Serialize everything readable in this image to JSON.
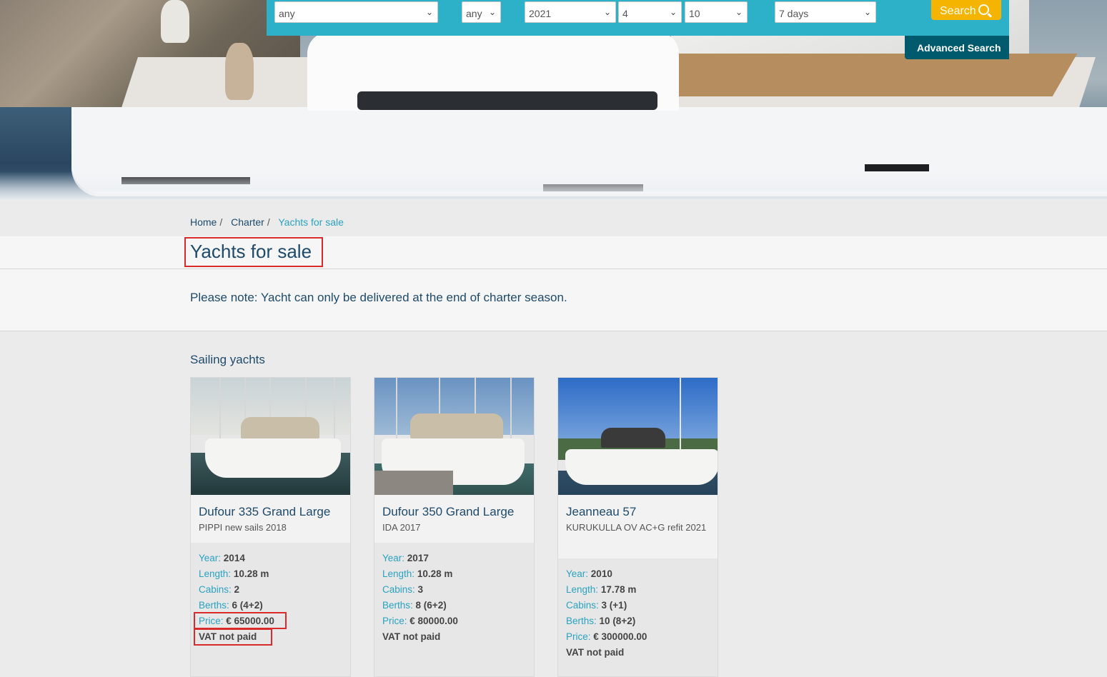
{
  "search": {
    "fields": [
      {
        "value": "any"
      },
      {
        "value": "any"
      },
      {
        "value": "2021"
      },
      {
        "value": "4"
      },
      {
        "value": "10"
      },
      {
        "value": "7 days"
      }
    ],
    "search_label": "Search",
    "advanced_label": "Advanced Search"
  },
  "breadcrumb": {
    "items": [
      "Home",
      "Charter",
      "Yachts for sale"
    ],
    "separator": "/"
  },
  "page": {
    "title": "Yachts for sale",
    "note": "Please note: Yacht can only be delivered at the end of charter season.",
    "section": "Sailing yachts"
  },
  "labels": {
    "year": "Year:",
    "length": "Length:",
    "cabins": "Cabins:",
    "berths": "Berths:",
    "price": "Price:"
  },
  "yachts": [
    {
      "name": "Dufour 335 Grand Large",
      "subtitle": "PIPPI new sails 2018",
      "year": "2014",
      "length": "10.28 m",
      "cabins": "2",
      "berths": "6 (4+2)",
      "price": "€ 65000.00",
      "vat": "VAT not paid"
    },
    {
      "name": "Dufour 350 Grand Large",
      "subtitle": "IDA 2017",
      "year": "2017",
      "length": "10.28 m",
      "cabins": "3",
      "berths": "8 (6+2)",
      "price": "€ 80000.00",
      "vat": "VAT not paid"
    },
    {
      "name": "Jeanneau 57",
      "subtitle": "KURUKULLA OV AC+G refit 2021",
      "year": "2010",
      "length": "17.78 m",
      "cabins": "3 (+1)",
      "berths": "10 (8+2)",
      "price": "€ 300000.00",
      "vat": "VAT not paid"
    }
  ],
  "colors": {
    "accent": "#2cb1c9",
    "search_button": "#f5b400",
    "advanced_button": "#005a6e",
    "heading": "#1e4a6b",
    "label": "#2aa2c1",
    "highlight": "#d92b2b"
  }
}
